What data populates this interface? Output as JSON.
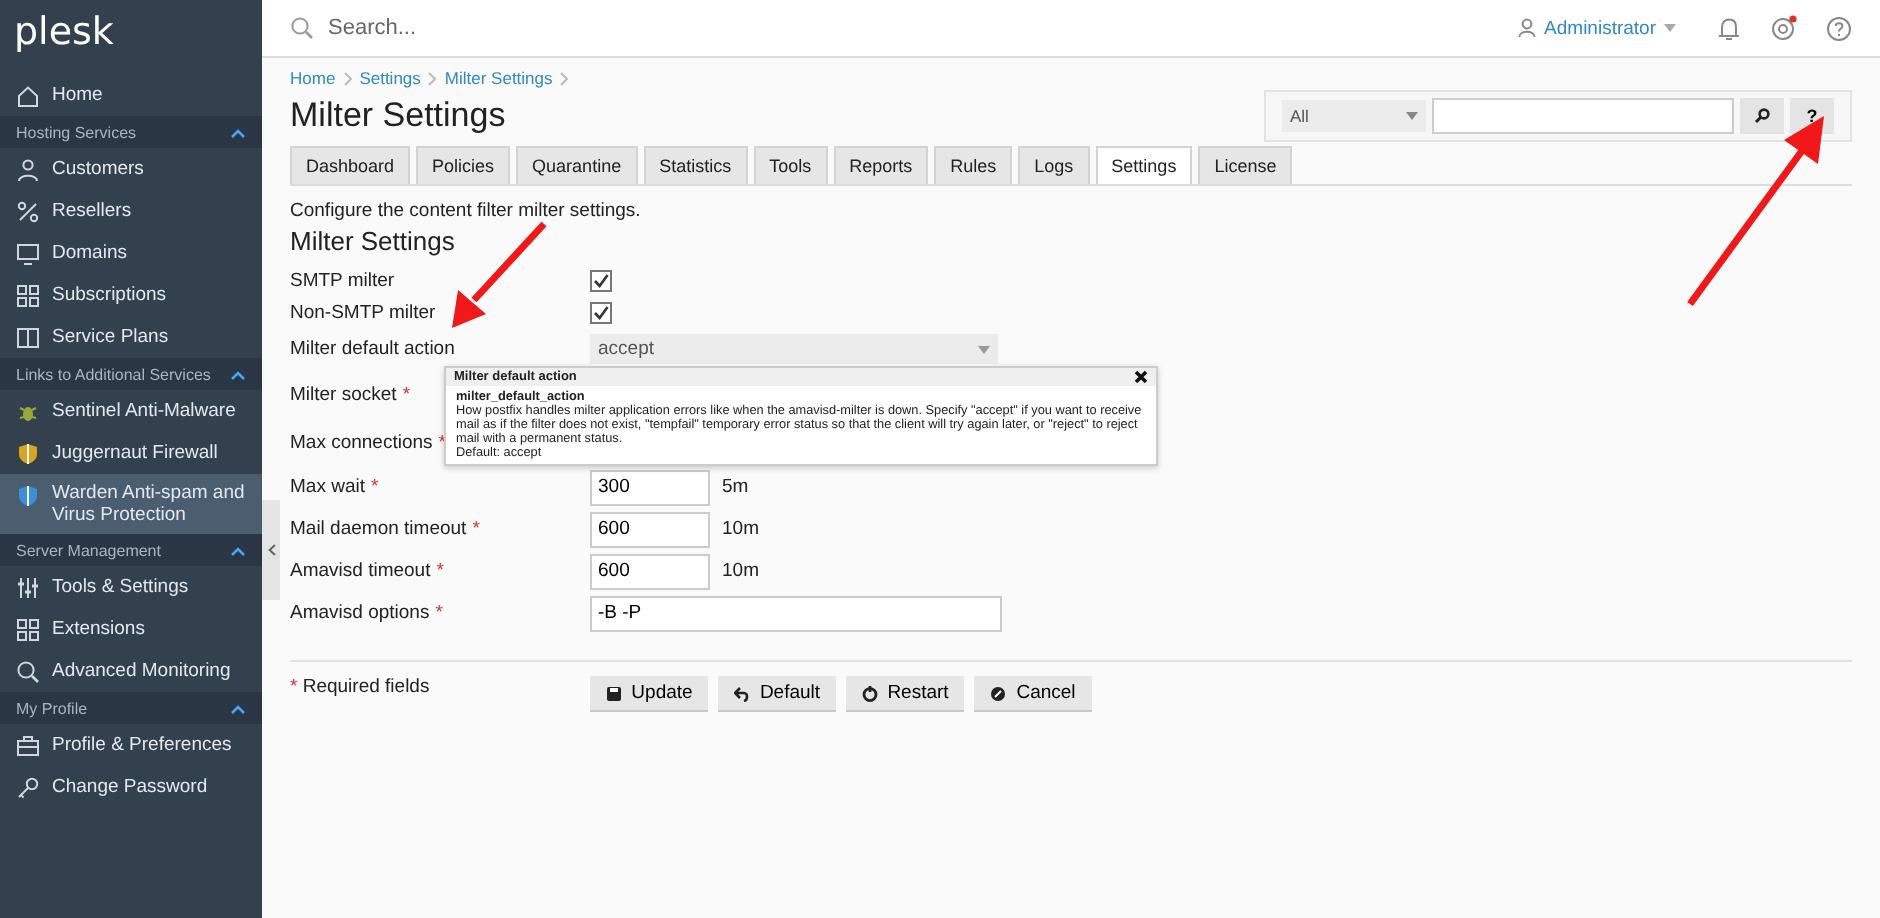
{
  "sidebar": {
    "logo": "plesk",
    "items": [
      {
        "kind": "item",
        "label": "Home",
        "selected": false
      },
      {
        "kind": "section",
        "label": "Hosting Services"
      },
      {
        "kind": "item",
        "label": "Customers",
        "selected": false
      },
      {
        "kind": "item",
        "label": "Resellers",
        "selected": false
      },
      {
        "kind": "item",
        "label": "Domains",
        "selected": false
      },
      {
        "kind": "item",
        "label": "Subscriptions",
        "selected": false
      },
      {
        "kind": "item",
        "label": "Service Plans",
        "selected": false
      },
      {
        "kind": "section",
        "label": "Links to Additional Services"
      },
      {
        "kind": "item",
        "label": "Sentinel Anti-Malware",
        "selected": false
      },
      {
        "kind": "item",
        "label": "Juggernaut Firewall",
        "selected": false
      },
      {
        "kind": "item",
        "label": "Warden Anti-spam and Virus Protection",
        "selected": true
      },
      {
        "kind": "section",
        "label": "Server Management"
      },
      {
        "kind": "item",
        "label": "Tools & Settings",
        "selected": false
      },
      {
        "kind": "item",
        "label": "Extensions",
        "selected": false
      },
      {
        "kind": "item",
        "label": "Advanced Monitoring",
        "selected": false
      },
      {
        "kind": "section",
        "label": "My Profile"
      },
      {
        "kind": "item",
        "label": "Profile & Preferences",
        "selected": false
      },
      {
        "kind": "item",
        "label": "Change Password",
        "selected": false
      }
    ]
  },
  "topbar": {
    "search_placeholder": "Search...",
    "user": "Administrator"
  },
  "breadcrumb": [
    "Home",
    "Settings",
    "Milter Settings"
  ],
  "title": "Milter Settings",
  "filter": {
    "select": "All",
    "help": "?"
  },
  "tabs": [
    {
      "label": "Dashboard",
      "selected": false
    },
    {
      "label": "Policies",
      "selected": false
    },
    {
      "label": "Quarantine",
      "selected": false
    },
    {
      "label": "Statistics",
      "selected": false
    },
    {
      "label": "Tools",
      "selected": false
    },
    {
      "label": "Reports",
      "selected": false
    },
    {
      "label": "Rules",
      "selected": false
    },
    {
      "label": "Logs",
      "selected": false
    },
    {
      "label": "Settings",
      "selected": true
    },
    {
      "label": "License",
      "selected": false
    }
  ],
  "description": "Configure the content filter milter settings.",
  "section_title": "Milter Settings",
  "fields": [
    {
      "kind": "checkbox",
      "label": "SMTP milter",
      "checked": true
    },
    {
      "kind": "checkbox",
      "label": "Non-SMTP milter",
      "checked": true
    },
    {
      "kind": "select",
      "label": "Milter default action",
      "value": "accept"
    },
    {
      "kind": "text",
      "label": "Milter socket",
      "mark": "*"
    },
    {
      "kind": "text",
      "label": "Max connections",
      "mark": "*"
    },
    {
      "kind": "text",
      "label": "Max wait",
      "mark": "*",
      "value": "300",
      "unit": "5m"
    },
    {
      "kind": "text",
      "label": "Mail daemon timeout",
      "mark": "*",
      "value": "600",
      "unit": "10m"
    },
    {
      "kind": "text",
      "label": "Amavisd timeout",
      "mark": "*",
      "value": "600",
      "unit": "10m"
    },
    {
      "kind": "wide",
      "label": "Amavisd options",
      "mark": "*",
      "value": "-B -P"
    }
  ],
  "tooltip": {
    "title": "Milter default action",
    "name": "milter_default_action",
    "body": "How postfix handles milter application errors like when the amavisd-milter is down. Specify \"accept\" if you want to receive mail as if the filter does not exist, \"tempfail\" temporary error status so that the client will try again later, or \"reject\" to reject mail with a permanent status.",
    "default": "Default: accept"
  },
  "required": {
    "mark": "*",
    "text": "Required fields"
  },
  "buttons": [
    "Update",
    "Default",
    "Restart",
    "Cancel"
  ]
}
